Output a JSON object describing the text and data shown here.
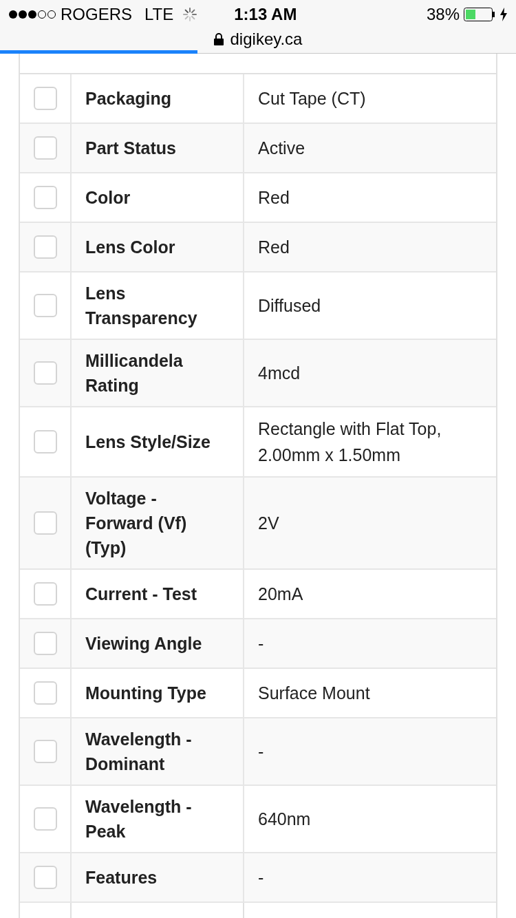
{
  "status_bar": {
    "carrier": "ROGERS",
    "network": "LTE",
    "time": "1:13 AM",
    "battery": "38%"
  },
  "address_bar": {
    "url": "digikey.ca",
    "load_progress": {
      "level": 0.383
    }
  },
  "attributes": [
    {
      "label": "Packaging",
      "value": "Cut Tape (CT)",
      "checked": false
    },
    {
      "label": "Part Status",
      "value": "Active",
      "checked": false
    },
    {
      "label": "Color",
      "value": "Red",
      "checked": false
    },
    {
      "label": "Lens Color",
      "value": "Red",
      "checked": false
    },
    {
      "label": "Lens Transparency",
      "value": "Diffused",
      "checked": false
    },
    {
      "label": "Millicandela Rating",
      "value": "4mcd",
      "checked": false
    },
    {
      "label": "Lens Style/Size",
      "value": "Rectangle with Flat Top, 2.00mm x 1.50mm",
      "checked": false
    },
    {
      "label": "Voltage - Forward (Vf) (Typ)",
      "value": "2V",
      "checked": false
    },
    {
      "label": "Current - Test",
      "value": "20mA",
      "checked": false
    },
    {
      "label": "Viewing Angle",
      "value": "-",
      "checked": false
    },
    {
      "label": "Mounting Type",
      "value": "Surface Mount",
      "checked": false
    },
    {
      "label": "Wavelength - Dominant",
      "value": "-",
      "checked": false
    },
    {
      "label": "Wavelength - Peak",
      "value": "640nm",
      "checked": false
    },
    {
      "label": "Features",
      "value": "-",
      "checked": false
    }
  ]
}
